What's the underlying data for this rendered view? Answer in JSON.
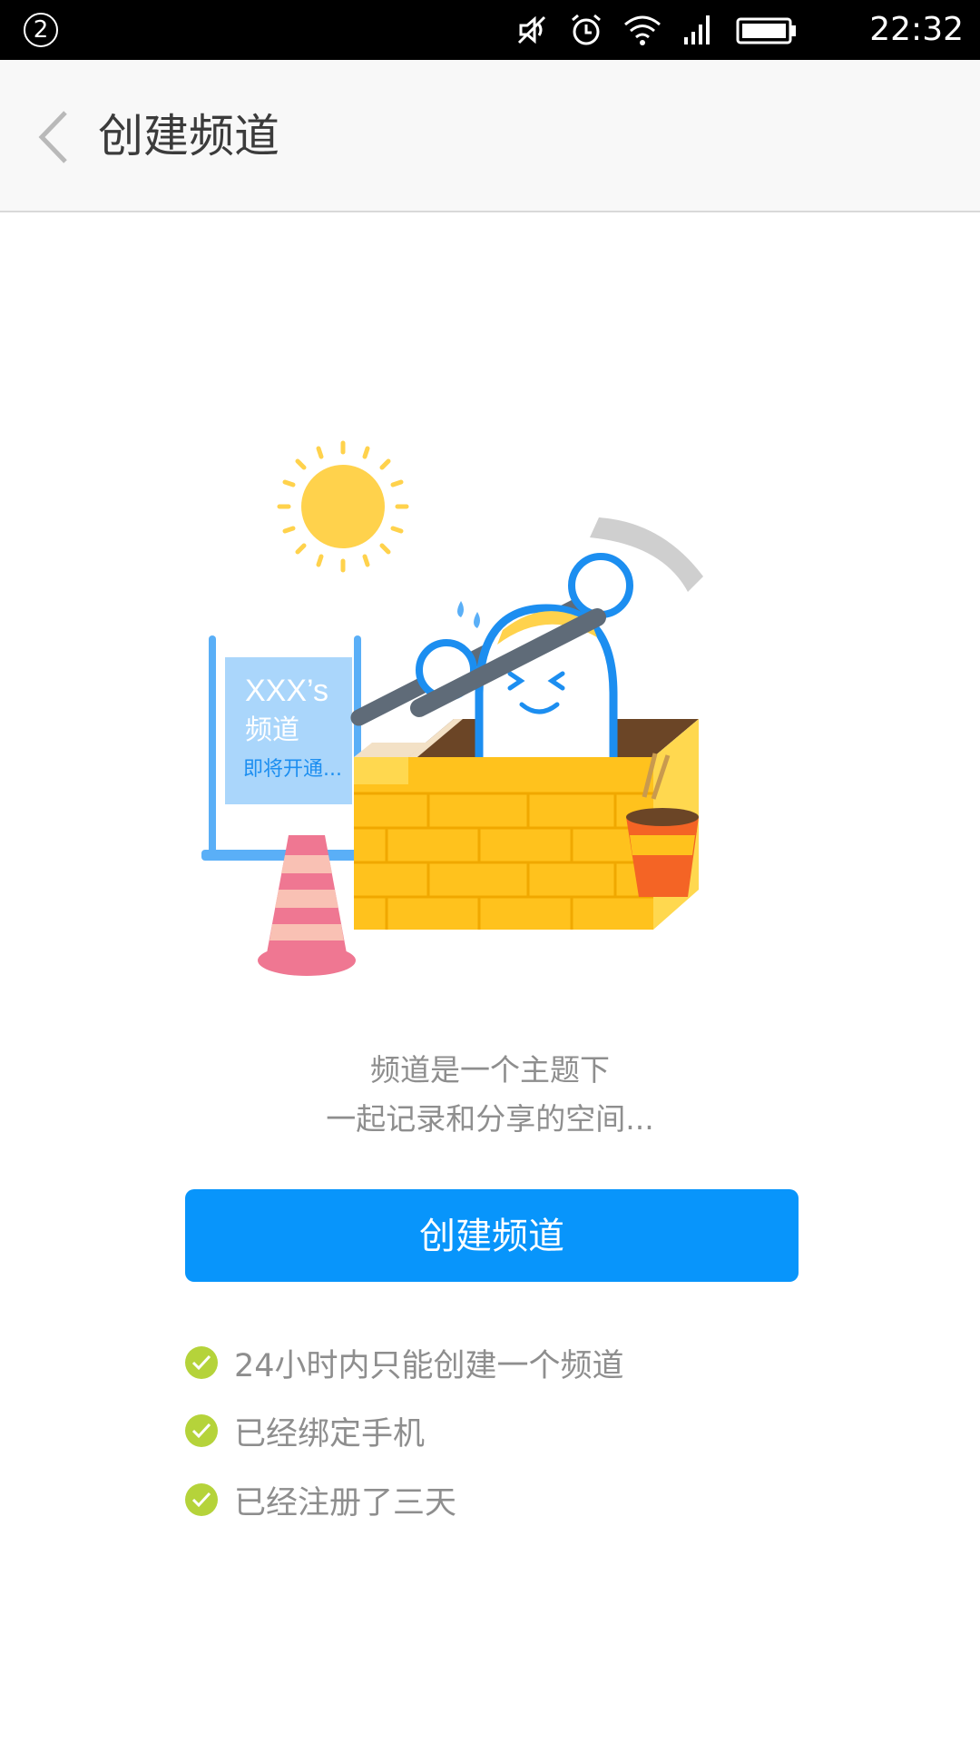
{
  "status_bar": {
    "notification_count": "2",
    "time": "22:32",
    "icons": [
      "mute-icon",
      "alarm-icon",
      "wifi-icon",
      "signal-icon",
      "battery-icon"
    ]
  },
  "header": {
    "back_icon": "chevron-left-icon",
    "title": "创建频道"
  },
  "illustration": {
    "sign_line1": "XXX’s",
    "sign_line2": "频道",
    "sign_line3": "即将开通..."
  },
  "description": {
    "line1": "频道是一个主题下",
    "line2": "一起记录和分享的空间..."
  },
  "create_button_label": "创建频道",
  "requirements": [
    {
      "label": "24小时内只能创建一个频道",
      "icon": "check-circle-icon"
    },
    {
      "label": "已经绑定手机",
      "icon": "check-circle-icon"
    },
    {
      "label": "已经注册了三天",
      "icon": "check-circle-icon"
    }
  ],
  "colors": {
    "accent": "#0895fb",
    "check": "#b5d33a",
    "text_secondary": "#8e8e8e"
  }
}
